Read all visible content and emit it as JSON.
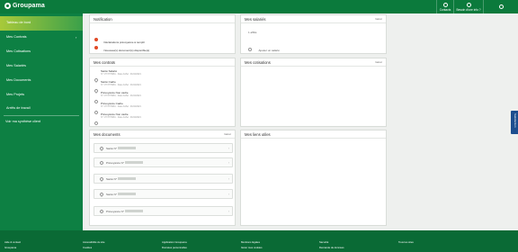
{
  "header": {
    "logo": "Groupama",
    "items": [
      {
        "label": "Contacts",
        "icon": "contact-icon"
      },
      {
        "label": "Besoin d'une info ?",
        "icon": "question-icon"
      },
      {
        "label": "",
        "icon": "user-icon"
      }
    ]
  },
  "sidebar": {
    "items": [
      {
        "label": "Tableau de bord"
      },
      {
        "label": "Mes Contrats"
      },
      {
        "label": "Mes Cotisations"
      },
      {
        "label": "Mes Salariés"
      },
      {
        "label": "Mes Documents"
      },
      {
        "label": "Mes Projets"
      },
      {
        "label": "Arrêts de travail"
      },
      {
        "label": "Voir ma synthèse client"
      }
    ]
  },
  "notification": {
    "title": "Notification",
    "items": [
      {
        "text": "Déclarations prévoyance à remplir"
      },
      {
        "text": "Nouveau(x) document(s) disponible(s)"
      }
    ]
  },
  "salaries": {
    "title": "Mes salariés",
    "more": "Gérer",
    "count": "1 affilié",
    "action": "Ajouter un salarié"
  },
  "contrats": {
    "title": "Mes contrats",
    "items": [
      {
        "name": "Santé Salarié",
        "meta": "N° 1773779981 · Date d'effet : 01/04/2021"
      },
      {
        "name": "Santé Cadre",
        "meta": "N° 1773779981 · Date d'effet : 01/04/2021"
      },
      {
        "name": "Prévoyance Non cadre",
        "meta": "N° 1773779981 · Date d'effet : 01/04/2021"
      },
      {
        "name": "Prévoyance Cadre",
        "meta": "N° 1773779981 · Date d'effet : 01/04/2021"
      },
      {
        "name": "Prévoyance Non cadre",
        "meta": "N° 1773779981 · Date d'effet : 01/04/2021"
      }
    ]
  },
  "cotisations": {
    "title": "Mes cotisations",
    "more": "Gérer"
  },
  "documents": {
    "title": "Mes documents",
    "more": "Gérer",
    "items": [
      {
        "label": "Santé N°"
      },
      {
        "label": "Prévoyance N°"
      },
      {
        "label": "Santé N°"
      },
      {
        "label": "Santé N°"
      },
      {
        "label": "Prévoyance N°"
      }
    ]
  },
  "liens": {
    "title": "Mes liens utiles"
  },
  "feedback": {
    "label": "Satisfaction"
  },
  "footer": {
    "links": [
      "Aide & contact",
      "Groupama",
      "Accessibilité du site",
      "Cookies",
      "Application Groupama",
      "Données personnelles",
      "Mentions légales",
      "Gérer mes cookies",
      "Sécurité",
      "Demande de données",
      "Tous les sites"
    ]
  }
}
